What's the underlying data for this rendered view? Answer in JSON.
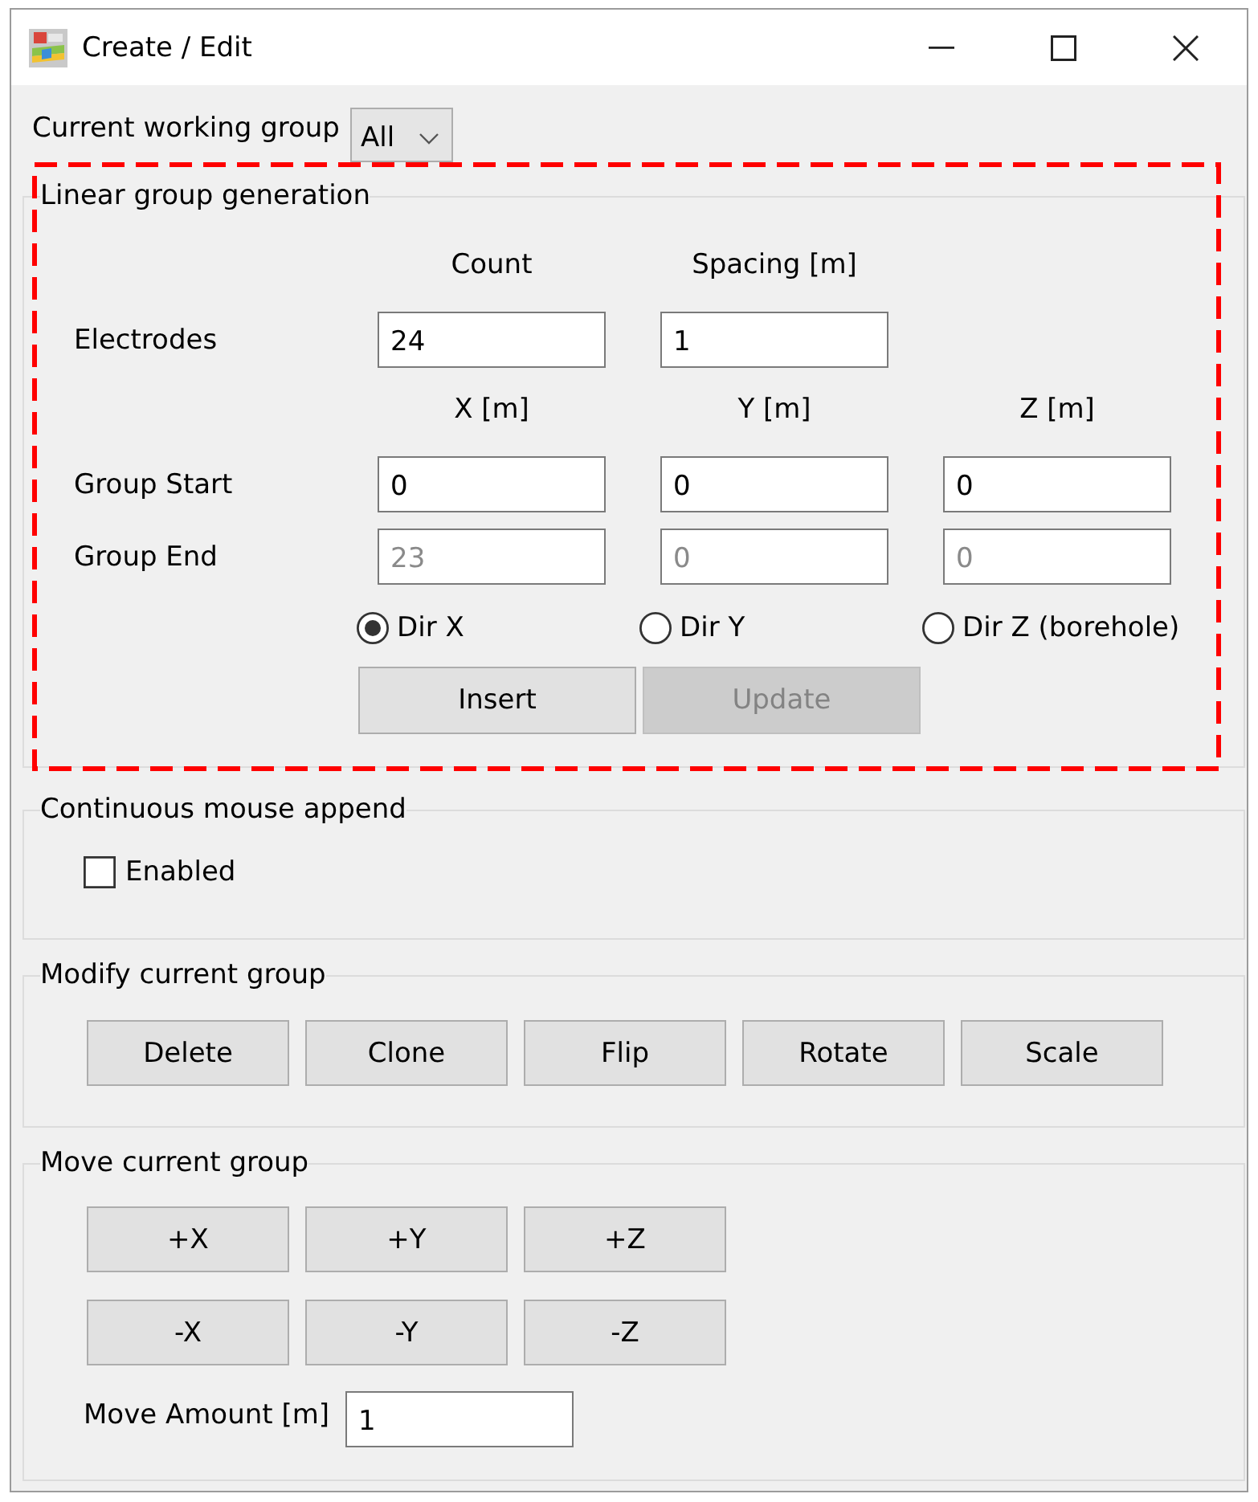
{
  "window": {
    "title": "Create / Edit"
  },
  "working_group": {
    "label": "Current working group",
    "value": "All"
  },
  "linear_group": {
    "title": "Linear group generation",
    "highlighted": true,
    "electrode_headers": [
      "Count",
      "Spacing [m]"
    ],
    "electrodes": {
      "label": "Electrodes",
      "fields": [
        {
          "value": "24",
          "disabled": false
        },
        {
          "value": "1",
          "disabled": false
        }
      ]
    },
    "coordinate_headers": [
      "X [m]",
      "Y [m]",
      "Z [m]"
    ],
    "coordinate_rows": [
      {
        "label": "Group Start",
        "fields": [
          {
            "value": "0",
            "disabled": false
          },
          {
            "value": "0",
            "disabled": false
          },
          {
            "value": "0",
            "disabled": false
          }
        ]
      },
      {
        "label": "Group End",
        "fields": [
          {
            "value": "23",
            "disabled": true
          },
          {
            "value": "0",
            "disabled": true
          },
          {
            "value": "0",
            "disabled": true
          }
        ]
      }
    ],
    "directions": [
      {
        "label": "Dir X",
        "selected": true
      },
      {
        "label": "Dir Y",
        "selected": false
      },
      {
        "label": "Dir Z (borehole)",
        "selected": false
      }
    ],
    "buttons": [
      {
        "label": "Insert",
        "disabled": false
      },
      {
        "label": "Update",
        "disabled": true
      }
    ]
  },
  "mouse_append": {
    "title": "Continuous mouse append",
    "checkbox": {
      "label": "Enabled",
      "checked": false
    }
  },
  "modify_group": {
    "title": "Modify current group",
    "buttons": [
      "Delete",
      "Clone",
      "Flip",
      "Rotate",
      "Scale"
    ]
  },
  "move_group": {
    "title": "Move current group",
    "button_rows": [
      [
        "+X",
        "+Y",
        "+Z"
      ],
      [
        "-X",
        "-Y",
        "-Z"
      ]
    ],
    "amount": {
      "label": "Move Amount [m]",
      "value": "1"
    }
  }
}
